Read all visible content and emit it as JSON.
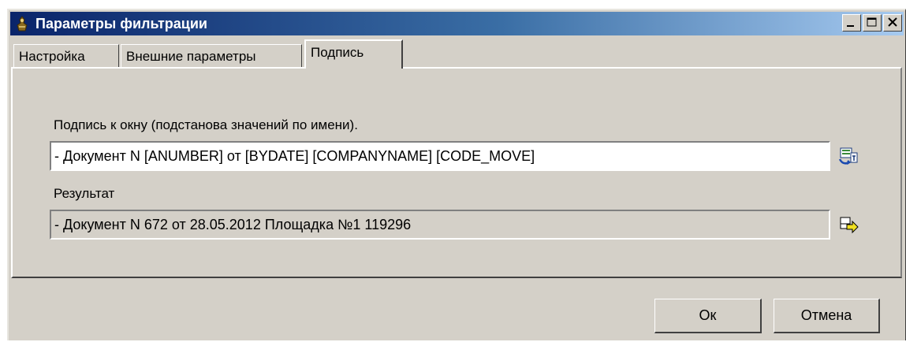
{
  "window": {
    "title": "Параметры фильтрации"
  },
  "title_buttons": {
    "minimize": "minimize-icon",
    "maximize": "maximize-icon",
    "close": "close-icon"
  },
  "tabs": [
    {
      "label": "Настройка",
      "active": false
    },
    {
      "label": "Внешние параметры",
      "active": false
    },
    {
      "label": "Подпись",
      "active": true
    }
  ],
  "caption": {
    "label": "Подпись к окну (подстанова значений по имени).",
    "value": "- Документ N [ANUMBER] от [BYDATE] [COMPANYNAME] [CODE_MOVE]",
    "icon": "insert-field-icon"
  },
  "result": {
    "label": "Результат",
    "value": "- Документ N 672 от 28.05.2012 Площадка №1 119296",
    "icon": "apply-arrow-icon"
  },
  "buttons": {
    "ok": "Ок",
    "cancel": "Отмена"
  },
  "colors": {
    "title_gradient_start": "#0a246a",
    "title_gradient_end": "#a6caf0",
    "face": "#d4d0c8"
  }
}
